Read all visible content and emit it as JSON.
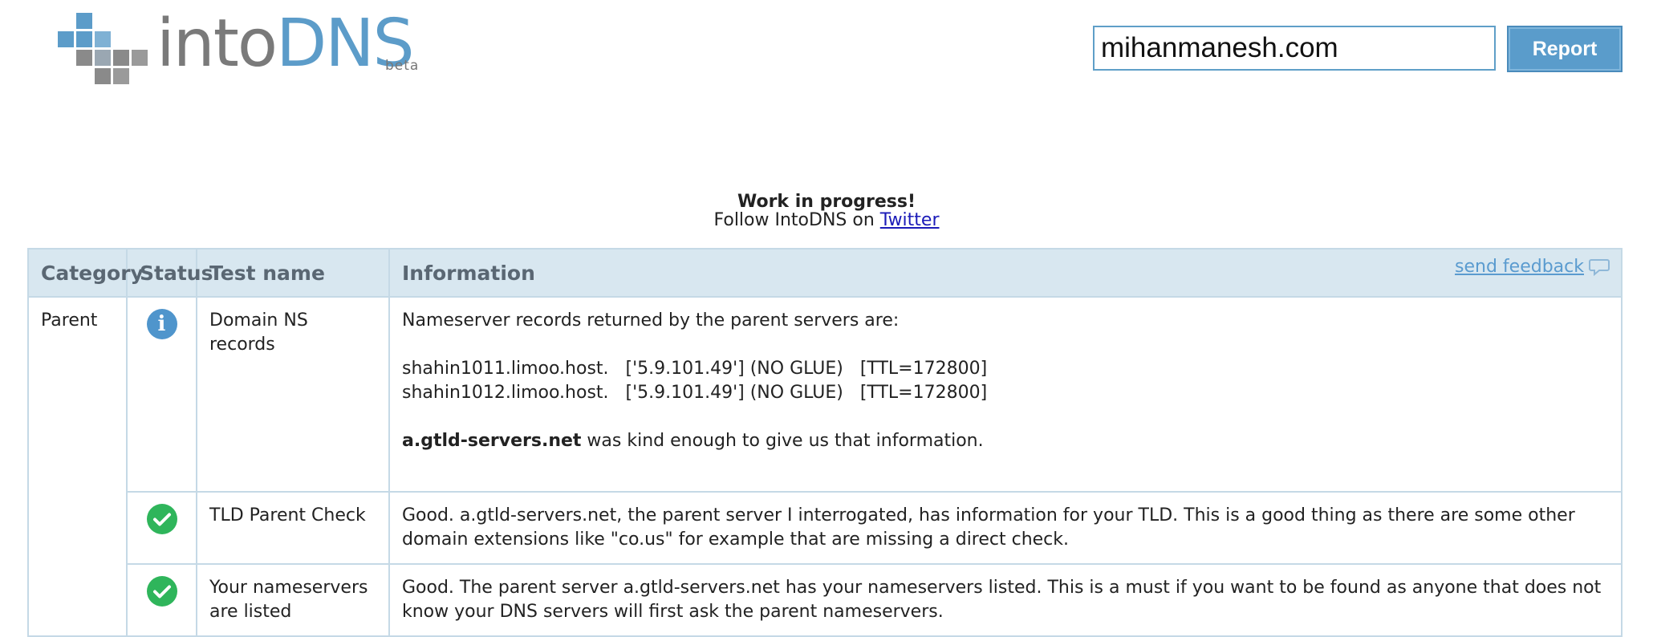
{
  "logo": {
    "into": "intoDNS",
    "beta": "beta"
  },
  "search": {
    "value": "mihanmanesh.com",
    "button_label": "Report"
  },
  "notice": {
    "title": "Work in progress!",
    "follow_prefix": "Follow IntoDNS on ",
    "follow_link": "Twitter"
  },
  "table": {
    "headers": {
      "category": "Category",
      "status": "Status",
      "test_name": "Test name",
      "information": "Information"
    },
    "feedback_label": "send feedback",
    "rows": [
      {
        "category": "Parent",
        "status": "info",
        "test_name": "Domain NS records",
        "info_intro": "Nameserver records returned by the parent servers are:",
        "ns_lines": [
          "shahin1011.limoo.host.   ['5.9.101.49'] (NO GLUE)   [TTL=172800]",
          "shahin1012.limoo.host.   ['5.9.101.49'] (NO GLUE)   [TTL=172800]"
        ],
        "info_bold": "a.gtld-servers.net",
        "info_tail": " was kind enough to give us that information."
      },
      {
        "status": "ok",
        "test_name": "TLD Parent Check",
        "info": "Good. a.gtld-servers.net, the parent server I interrogated, has information for your TLD. This is a good thing as there are some other domain extensions like \"co.us\" for example that are missing a direct check."
      },
      {
        "status": "ok",
        "test_name": "Your nameservers are listed",
        "info": "Good. The parent server a.gtld-servers.net has your nameservers listed. This is a must if you want to be found as anyone that does not know your DNS servers will first ask the parent nameservers."
      }
    ]
  },
  "colors": {
    "brand_blue": "#5c9cc9",
    "brand_gray": "#7a7a7a",
    "ok_green": "#2fb55b",
    "info_blue": "#4f95cc",
    "header_bg": "#d8e7f0"
  }
}
